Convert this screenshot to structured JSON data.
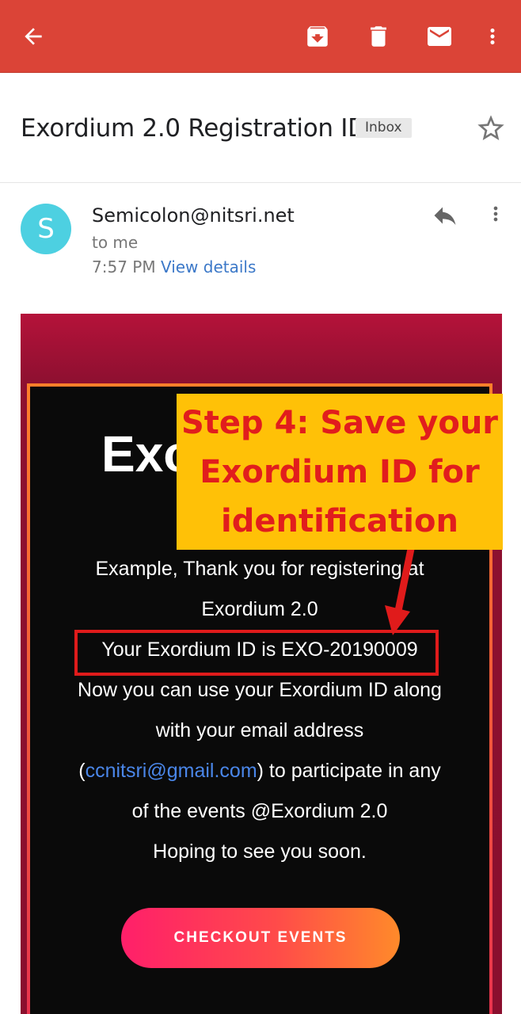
{
  "appbar": {
    "back_icon": "arrow-back-icon",
    "actions": [
      "archive-icon",
      "delete-icon",
      "mail-icon",
      "more-vert-icon"
    ],
    "color": "#db4437"
  },
  "email": {
    "subject": "Exordium 2.0 Registration ID",
    "label": "Inbox",
    "sender_initial": "S",
    "sender": "Semicolon@nitsri.net",
    "recipient": "to me",
    "time": "7:57 PM",
    "details_link": "View details"
  },
  "content": {
    "title": "Exo",
    "lines": {
      "line1": "Example, Thank you for registering at",
      "line2": "Exordium 2.0",
      "line3": "Your Exordium ID is EXO-20190009",
      "line4": "Now you can use your Exordium ID along",
      "line5": "with your email address",
      "email": "ccnitsri@gmail.com",
      "line6_open": "(",
      "line6_rest": ") to participate in any",
      "line7": "of the events @Exordium 2.0",
      "line8": "Hoping to see you soon."
    },
    "cta_label": "CHECKOUT EVENTS"
  },
  "annotation": {
    "text_line1": "Step 4: Save your",
    "text_line2": "Exordium ID for",
    "text_line3": "identification",
    "bg_color": "#ffc107",
    "text_color": "#e11d1d"
  }
}
